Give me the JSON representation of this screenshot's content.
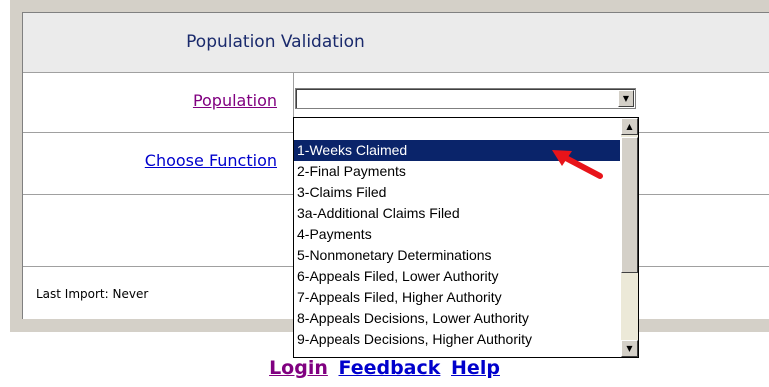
{
  "header": {
    "title": "Population Validation"
  },
  "form": {
    "population_label": "Population",
    "choose_function_label": "Choose Function",
    "population_select": {
      "value": ""
    },
    "last_import": "Last Import: Never"
  },
  "dropdown": {
    "options": [
      "1-Weeks Claimed",
      "2-Final Payments",
      "3-Claims Filed",
      "3a-Additional Claims Filed",
      "4-Payments",
      "5-Nonmonetary Determinations",
      "6-Appeals Filed, Lower Authority",
      "7-Appeals Filed, Higher Authority",
      "8-Appeals Decisions, Lower Authority",
      "9-Appeals Decisions, Higher Authority"
    ],
    "highlighted_index": 0
  },
  "footer": {
    "login": "Login",
    "feedback": "Feedback",
    "help": "Help"
  },
  "colors": {
    "highlight": "#0a246a",
    "link": "#0000cc",
    "visited_link": "#800080",
    "arrow": "#e8141a"
  }
}
